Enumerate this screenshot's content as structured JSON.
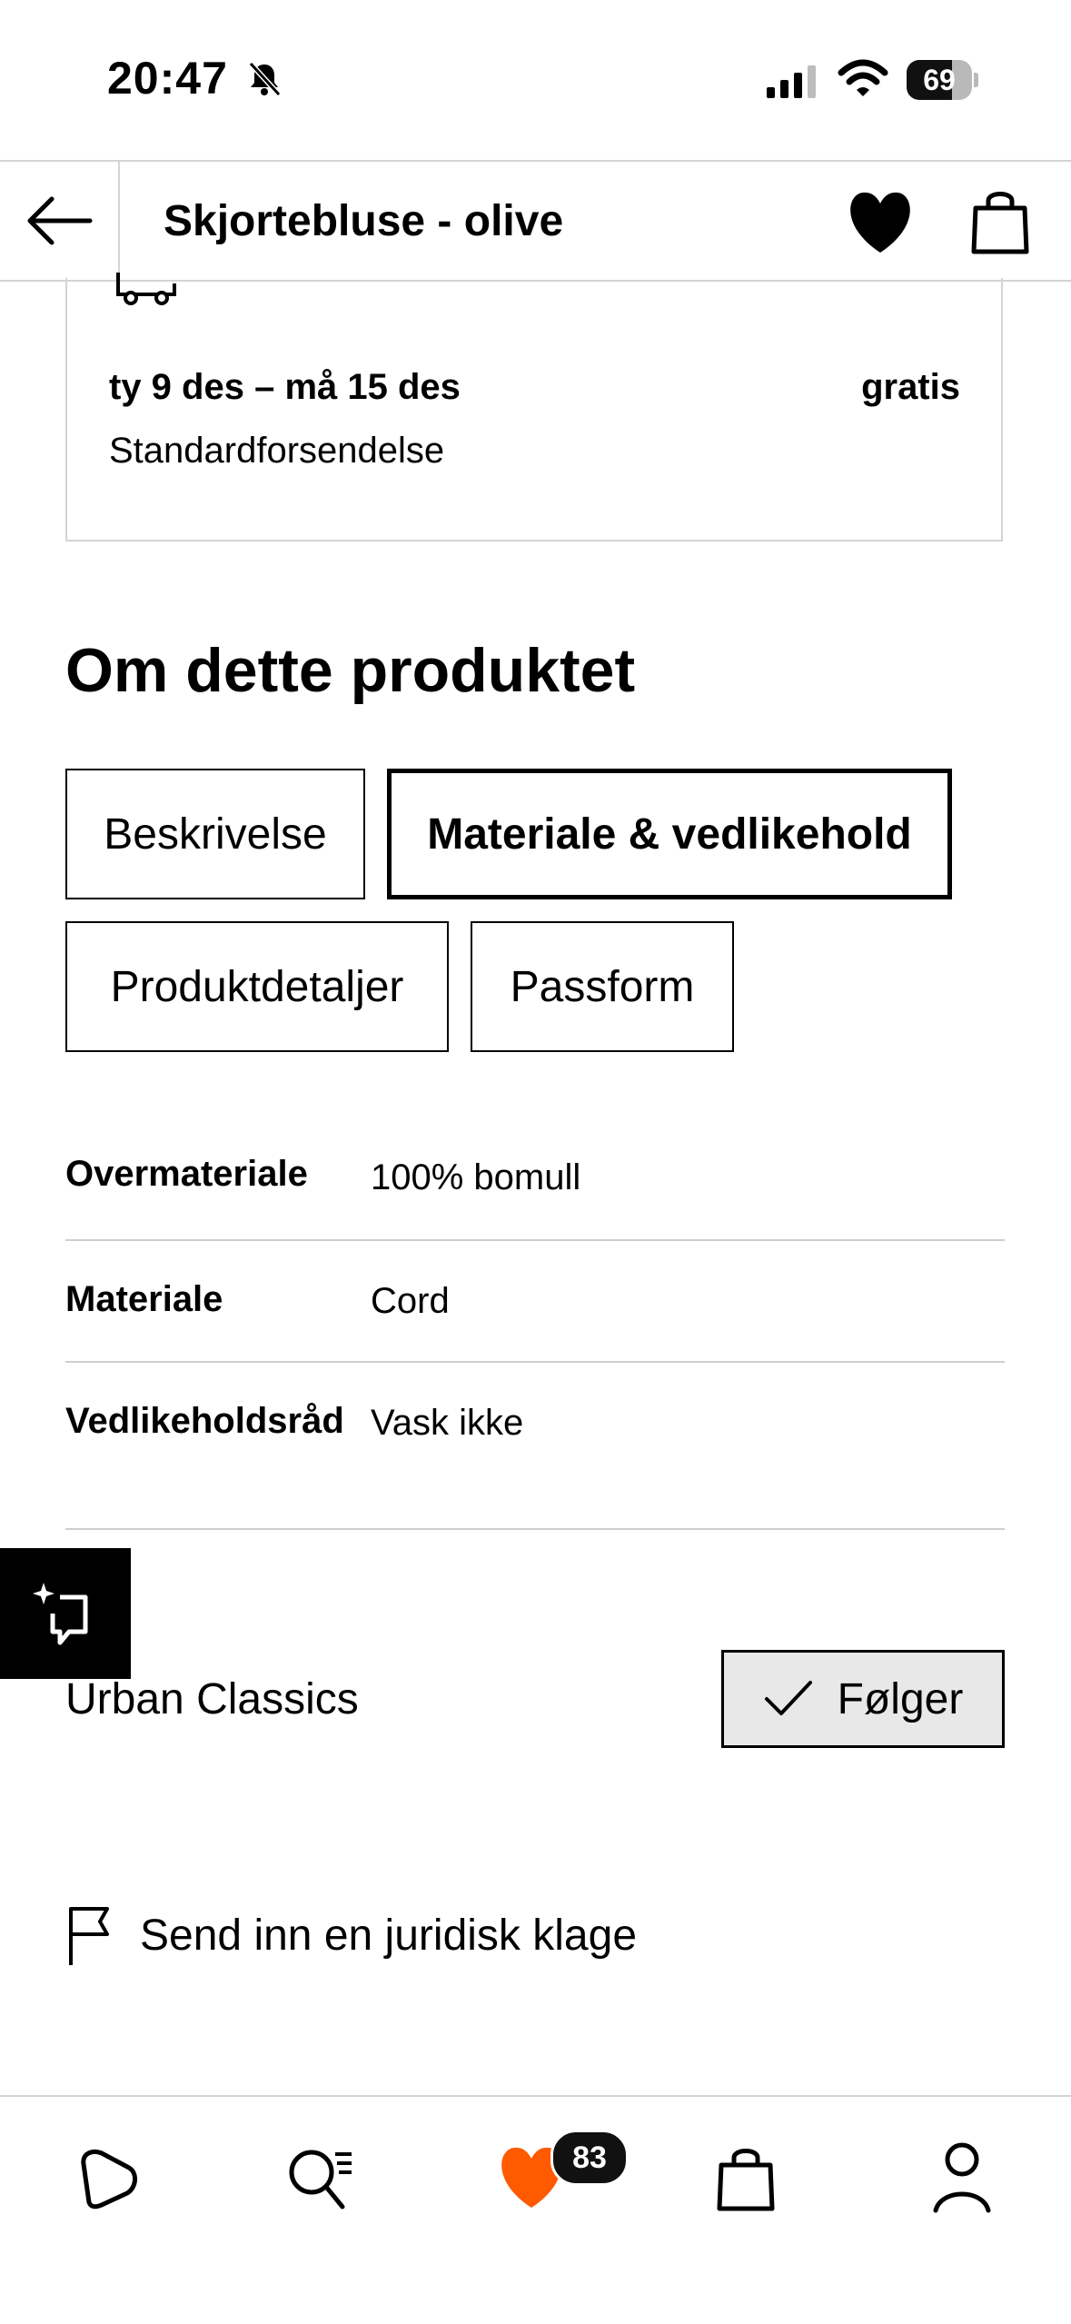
{
  "status_bar": {
    "time": "20:47",
    "battery": "69",
    "battery_level": 0.69
  },
  "header": {
    "title": "Skjortebluse - olive"
  },
  "shipping": {
    "date_range": "ty 9 des – må 15 des",
    "price": "gratis",
    "method": "Standardforsendelse"
  },
  "about": {
    "title": "Om dette produktet",
    "tabs": [
      {
        "label": "Beskrivelse",
        "active": false
      },
      {
        "label": "Materiale & vedlikehold",
        "active": true
      },
      {
        "label": "Produktdetaljer",
        "active": false
      },
      {
        "label": "Passform",
        "active": false
      }
    ],
    "materials": [
      {
        "label": "Overmateriale",
        "value": "100% bomull"
      },
      {
        "label": "Materiale",
        "value": "Cord"
      },
      {
        "label": "Vedlikeholdsråd",
        "value": "Vask ikke"
      }
    ]
  },
  "brand": {
    "name": "Urban Classics",
    "follow_label": "Følger"
  },
  "complaint": {
    "label": "Send inn en juridisk klage"
  },
  "bottom_nav": {
    "items": [
      "home-icon",
      "search-icon",
      "wishlist-icon",
      "bag-icon",
      "profile-icon"
    ],
    "wishlist_count": "83"
  },
  "colors": {
    "accent": "#ff5a00",
    "border": "#d4d4d4",
    "text": "#000000"
  }
}
